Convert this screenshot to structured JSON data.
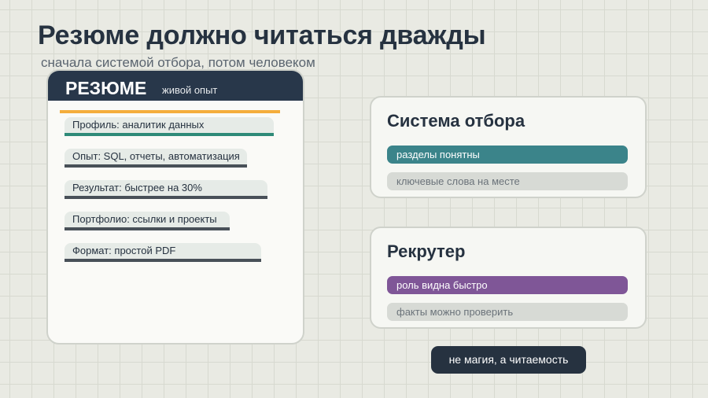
{
  "title": "Резюме должно читаться дважды",
  "subtitle": "сначала системой отбора, потом человеком",
  "resume": {
    "title": "РЕЗЮМЕ",
    "subtitle": "живой опыт",
    "rows": [
      "Профиль: аналитик данных",
      "Опыт: SQL, отчеты, автоматизация",
      "Результат: быстрее на 30%",
      "Портфолио: ссылки и проекты",
      "Формат: простой PDF"
    ]
  },
  "ats_card": {
    "title": "Система отбора",
    "items": [
      "разделы понятны",
      "ключевые слова на месте"
    ]
  },
  "recruiter_card": {
    "title": "Рекрутер",
    "items": [
      "роль видна быстро",
      "факты можно проверить"
    ]
  },
  "footer": "не магия, а читаемость",
  "colors": {
    "dark": "#263240",
    "teal": "#3b848a",
    "purple": "#7f5697",
    "accent": "#f4ad3c",
    "green": "#2e8a78"
  }
}
